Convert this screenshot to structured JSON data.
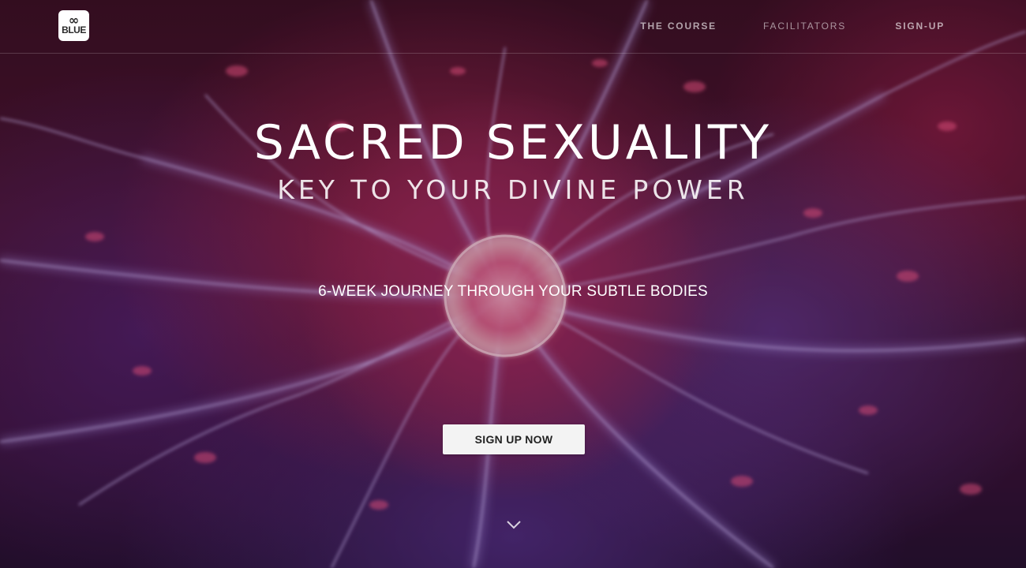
{
  "brand": {
    "logo_symbol": "∞",
    "logo_text": "BLUE"
  },
  "nav": {
    "items": [
      {
        "label": "THE COURSE"
      },
      {
        "label": "FACILITATORS"
      },
      {
        "label": "SIGN-UP"
      }
    ]
  },
  "hero": {
    "title": "SACRED SEXUALITY",
    "subtitle": "KEY TO YOUR DIVINE POWER",
    "tagline": "6-WEEK JOURNEY THROUGH YOUR SUBTLE BODIES",
    "cta_label": "SIGN UP NOW",
    "scroll_icon": "chevron-down-icon",
    "background": "plasma-ball-image"
  },
  "colors": {
    "cta_background": "#f3f3f3",
    "text": "#ffffff",
    "background_dark": "#3a0f22",
    "accent_pink": "#c04470",
    "accent_violet": "#8a6ad0"
  }
}
